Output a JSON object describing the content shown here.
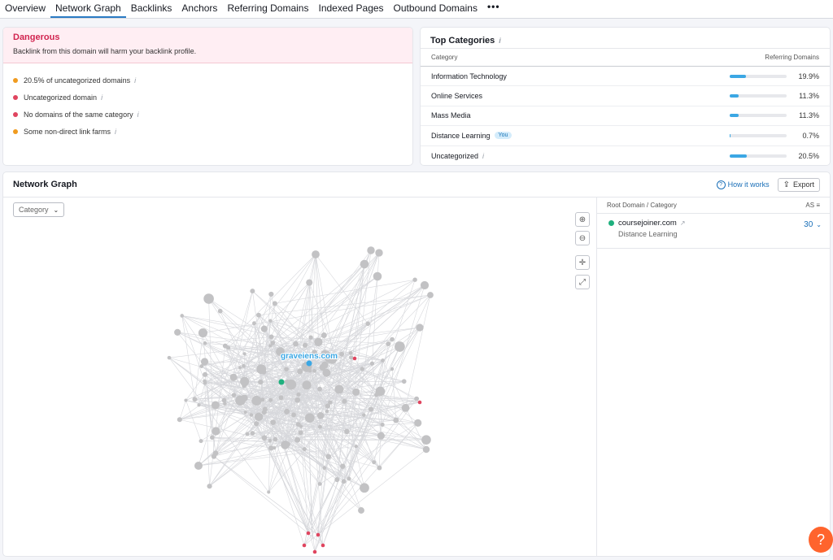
{
  "tabs": [
    {
      "label": "Overview"
    },
    {
      "label": "Network Graph",
      "active": true
    },
    {
      "label": "Backlinks"
    },
    {
      "label": "Anchors"
    },
    {
      "label": "Referring Domains"
    },
    {
      "label": "Indexed Pages"
    },
    {
      "label": "Outbound Domains"
    },
    {
      "label": "•••"
    }
  ],
  "danger": {
    "title": "Dangerous",
    "description": "Backlink from this domain will harm your backlink profile.",
    "issues": [
      {
        "text": "20.5% of uncategorized domains",
        "color": "#f09b1f"
      },
      {
        "text": "Uncategorized domain",
        "color": "#e0455f"
      },
      {
        "text": "No domains of the same category",
        "color": "#e0455f"
      },
      {
        "text": "Some non-direct link farms",
        "color": "#f09b1f"
      }
    ]
  },
  "categories": {
    "title": "Top Categories",
    "col_category": "Category",
    "col_domains": "Referring Domains",
    "you_label": "You",
    "rows": [
      {
        "name": "Information Technology",
        "pct": "19.9%",
        "value": 19.9
      },
      {
        "name": "Online Services",
        "pct": "11.3%",
        "value": 11.3
      },
      {
        "name": "Mass Media",
        "pct": "11.3%",
        "value": 11.3
      },
      {
        "name": "Distance Learning",
        "pct": "0.7%",
        "value": 0.7,
        "you": true
      },
      {
        "name": "Uncategorized",
        "pct": "20.5%",
        "value": 20.5
      }
    ]
  },
  "network": {
    "title": "Network Graph",
    "how_it_works": "How it works",
    "export": "Export",
    "category_select": "Category",
    "center_label": "graveiens.com",
    "node_color": "#c2c2c4",
    "center_color": "#3ba7e4",
    "green_color": "#1fb07e",
    "red_color": "#e0455f"
  },
  "side": {
    "col_domain": "Root Domain / Category",
    "col_as": "AS",
    "row": {
      "domain": "coursejoiner.com",
      "category": "Distance Learning",
      "as": "30",
      "color": "#1fb07e"
    }
  },
  "help": "?"
}
